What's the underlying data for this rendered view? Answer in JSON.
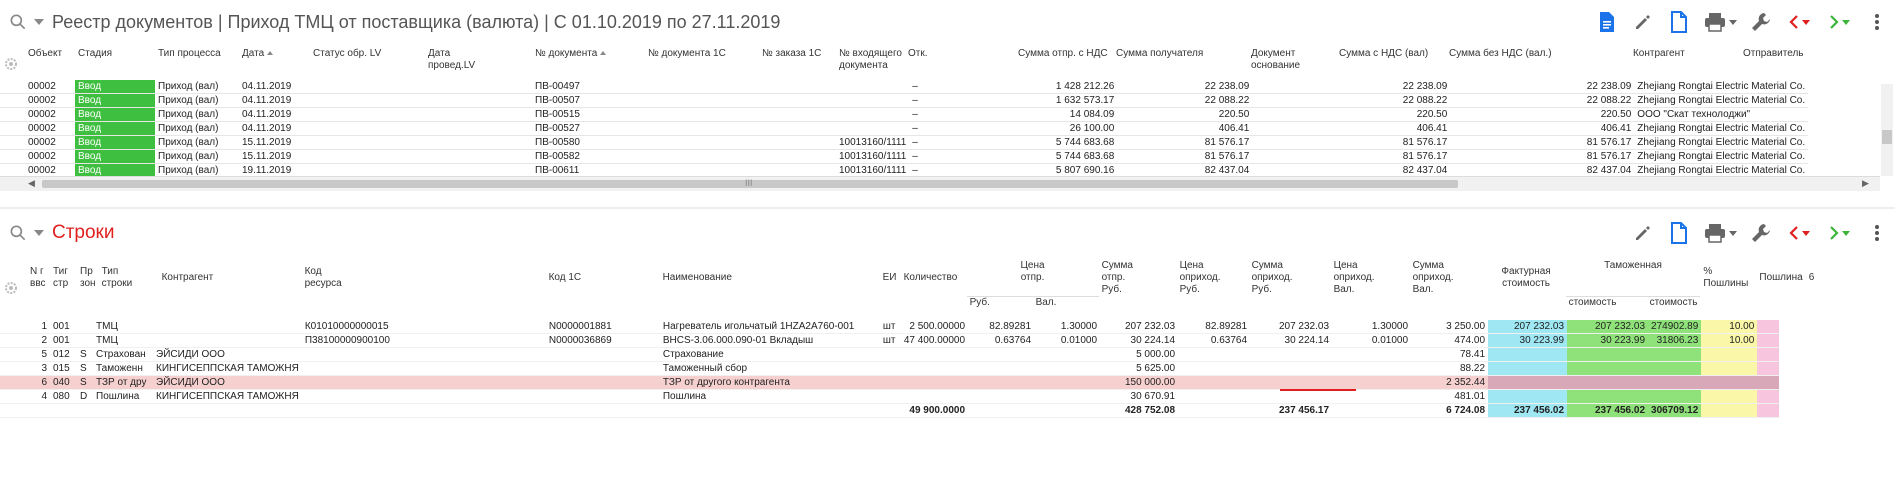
{
  "top_panel": {
    "title": "Реестр документов | Приход ТМЦ от поставщика (валюта) | С 01.10.2019 по 27.11.2019",
    "columns": [
      "Объект",
      "Стадия",
      "Тип процесса",
      "Дата",
      "Статус обр. LV",
      "Дата проведLV",
      "№ документа",
      "№ документа 1С",
      "№ заказа 1С",
      "№ входящего документа",
      "Отк.",
      "Сумма отпр. с НДС",
      "Сумма получателя",
      "Документ основание",
      "Сумма с НДС (вал)",
      "Сумма без НДС (вал.)",
      "Контрагент",
      "Отправитель"
    ],
    "col_labels": {
      "obj": "Объект",
      "stage": "Стадия",
      "proc": "Тип процесса",
      "date": "Дата",
      "status": "Статус обр. LV",
      "dprov1": "Дата",
      "dprov2": "провед.LV",
      "docno": "№ документа",
      "doc1c": "№ документа 1С",
      "order1c": "№ заказа 1С",
      "incoming1": "№ входящего",
      "incoming2": "документа",
      "otk": "Отк.",
      "sum_otpr": "Сумма отпр. с НДС",
      "sum_pol": "Сумма получателя",
      "osn1": "Документ",
      "osn2": "основание",
      "sum_nds": "Сумма с НДС (вал)",
      "sum_bez": "Сумма без НДС (вал.)",
      "contr": "Контрагент",
      "sender": "Отправитель"
    },
    "rows": [
      {
        "obj": "00002",
        "stage": "Ввод",
        "proc": "Приход (вал)",
        "date": "04.11.2019",
        "docno": "ПВ-00497",
        "incoming": "",
        "otk": "–",
        "sum_otpr": "1 428 212.26",
        "sum_pol": "22 238.09",
        "sum_nds": "22 238.09",
        "sum_bez": "22 238.09",
        "contr": "Zhejiang Rongtai Electric Material Co."
      },
      {
        "obj": "00002",
        "stage": "Ввод",
        "proc": "Приход (вал)",
        "date": "04.11.2019",
        "docno": "ПВ-00507",
        "incoming": "",
        "otk": "–",
        "sum_otpr": "1 632 573.17",
        "sum_pol": "22 088.22",
        "sum_nds": "22 088.22",
        "sum_bez": "22 088.22",
        "contr": "Zhejiang Rongtai Electric Material Co."
      },
      {
        "obj": "00002",
        "stage": "Ввод",
        "proc": "Приход (вал)",
        "date": "04.11.2019",
        "docno": "ПВ-00515",
        "incoming": "",
        "otk": "–",
        "sum_otpr": "14 084.09",
        "sum_pol": "220.50",
        "sum_nds": "220.50",
        "sum_bez": "220.50",
        "contr": "ООО \"Скат технолоджи\""
      },
      {
        "obj": "00002",
        "stage": "Ввод",
        "proc": "Приход (вал)",
        "date": "04.11.2019",
        "docno": "ПВ-00527",
        "incoming": "",
        "otk": "–",
        "sum_otpr": "26 100.00",
        "sum_pol": "406.41",
        "sum_nds": "406.41",
        "sum_bez": "406.41",
        "contr": "Zhejiang Rongtai Electric Material Co."
      },
      {
        "obj": "00002",
        "stage": "Ввод",
        "proc": "Приход (вал)",
        "date": "15.11.2019",
        "docno": "ПВ-00580",
        "incoming": "10013160/1111",
        "otk": "–",
        "sum_otpr": "5 744 683.68",
        "sum_pol": "81 576.17",
        "sum_nds": "81 576.17",
        "sum_bez": "81 576.17",
        "contr": "Zhejiang Rongtai Electric Material Co."
      },
      {
        "obj": "00002",
        "stage": "Ввод",
        "proc": "Приход (вал)",
        "date": "15.11.2019",
        "docno": "ПВ-00582",
        "incoming": "10013160/1111",
        "otk": "–",
        "sum_otpr": "5 744 683.68",
        "sum_pol": "81 576.17",
        "sum_nds": "81 576.17",
        "sum_bez": "81 576.17",
        "contr": "Zhejiang Rongtai Electric Material Co."
      },
      {
        "obj": "00002",
        "stage": "Ввод",
        "proc": "Приход (вал)",
        "date": "19.11.2019",
        "docno": "ПВ-00611",
        "incoming": "10013160/1111",
        "otk": "–",
        "sum_otpr": "5 807 690.16",
        "sum_pol": "82 437.04",
        "sum_nds": "82 437.04",
        "sum_bez": "82 437.04",
        "contr": "Zhejiang Rongtai Electric Material Co."
      }
    ],
    "scroll_grip": "III"
  },
  "bottom_panel": {
    "title": "Строки",
    "col_labels": {
      "n1": "N г",
      "n2": "ввс",
      "tip1": "Тиг",
      "tip2": "стр",
      "pr1": "Пр",
      "pr2": "зон",
      "tipstr1": "Тип",
      "tipstr2": "строки",
      "contr": "Контрагент",
      "kod1": "Код",
      "kod2": "ресурса",
      "kod1c": "Код 1С",
      "name": "Наименование",
      "ei": "ЕИ",
      "qty": "Количество",
      "price1": "Цена",
      "price2": "отпр.",
      "rub": "Руб.",
      "val": "Вал.",
      "sumotpr1": "Сумма",
      "sumotpr2": "отпр.",
      "sumotpr3": "Руб.",
      "cenaopr1": "Цена",
      "cenaopr2": "оприход.",
      "cenaopr3": "Руб.",
      "sumopr1": "Сумма",
      "sumopr2": "оприход.",
      "sumopr3": "Руб.",
      "cenaoprv1": "Цена",
      "cenaoprv2": "оприход.",
      "cenaoprv3": "Вал.",
      "sumoprv1": "Сумма",
      "sumoprv2": "оприход.",
      "sumoprv3": "Вал.",
      "fakt1": "Фактурная",
      "fakt2": "стоимость",
      "tam": "Таможенная",
      "stoim_a": "стоимость",
      "stoim_b": "стоимость",
      "pct1": "%",
      "pct2": "Пошлины",
      "poshlina": "Пошлина",
      "extra": "6"
    },
    "rows": [
      {
        "n": "1",
        "tip": "001",
        "pr": "",
        "tipstr": "ТМЦ",
        "contr": "",
        "kod": "К01010000000015",
        "kod1c": "N0000001881",
        "name": "Нагреватель игольчатый 1HZA2A760-001",
        "ei": "шт",
        "qty": "2 500.00000",
        "price_rub": "82.89281",
        "price_val": "1.30000",
        "sum_otpr": "207 232.03",
        "cena_opr": "82.89281",
        "sum_opr": "207 232.03",
        "cena_oprv": "1.30000",
        "sum_oprv": "3 250.00",
        "fakt": "207 232.03",
        "tam_a": "207 232.03",
        "tam_b": "274902.89",
        "pct": "10.00",
        "poshlina": "",
        "hl": false
      },
      {
        "n": "2",
        "tip": "001",
        "pr": "",
        "tipstr": "ТМЦ",
        "contr": "",
        "kod": "П38100000900100",
        "kod1c": "N0000036869",
        "name": "BHCS-3.06.000.090-01 Вкладыш",
        "ei": "шт",
        "qty": "47 400.00000",
        "price_rub": "0.63764",
        "price_val": "0.01000",
        "sum_otpr": "30 224.14",
        "cena_opr": "0.63764",
        "sum_opr": "30 224.14",
        "cena_oprv": "0.01000",
        "sum_oprv": "474.00",
        "fakt": "30 223.99",
        "tam_a": "30 223.99",
        "tam_b": "31806.23",
        "pct": "10.00",
        "poshlina": "",
        "hl": false
      },
      {
        "n": "5",
        "tip": "012",
        "pr": "S",
        "tipstr": "Страхован",
        "contr": "ЭЙСИДИ ООО",
        "kod": "",
        "kod1c": "",
        "name": "Страхование",
        "ei": "",
        "qty": "",
        "price_rub": "",
        "price_val": "",
        "sum_otpr": "5 000.00",
        "cena_opr": "",
        "sum_opr": "",
        "cena_oprv": "",
        "sum_oprv": "78.41",
        "fakt": "",
        "tam_a": "",
        "tam_b": "",
        "pct": "",
        "poshlina": "",
        "hl": false
      },
      {
        "n": "3",
        "tip": "015",
        "pr": "S",
        "tipstr": "Таможенн",
        "contr": "КИНГИСЕППСКАЯ ТАМОЖНЯ",
        "kod": "",
        "kod1c": "",
        "name": "Таможенный сбор",
        "ei": "",
        "qty": "",
        "price_rub": "",
        "price_val": "",
        "sum_otpr": "5 625.00",
        "cena_opr": "",
        "sum_opr": "",
        "cena_oprv": "",
        "sum_oprv": "88.22",
        "fakt": "",
        "tam_a": "",
        "tam_b": "",
        "pct": "",
        "poshlina": "",
        "hl": false
      },
      {
        "n": "6",
        "tip": "040",
        "pr": "S",
        "tipstr": "ТЗР от дру",
        "contr": "ЭЙСИДИ ООО",
        "kod": "",
        "kod1c": "",
        "name": "ТЗР от другого контрагента",
        "ei": "",
        "qty": "",
        "price_rub": "",
        "price_val": "",
        "sum_otpr": "150 000.00",
        "cena_opr": "",
        "sum_opr": "",
        "cena_oprv": "",
        "sum_oprv": "2 352.44",
        "fakt": "",
        "tam_a": "",
        "tam_b": "",
        "pct": "",
        "poshlina": "",
        "hl": true
      },
      {
        "n": "4",
        "tip": "080",
        "pr": "D",
        "tipstr": "Пошлина",
        "contr": "КИНГИСЕППСКАЯ ТАМОЖНЯ",
        "kod": "",
        "kod1c": "",
        "name": "Пошлина",
        "ei": "",
        "qty": "",
        "price_rub": "",
        "price_val": "",
        "sum_otpr": "30 670.91",
        "cena_opr": "",
        "sum_opr": "",
        "cena_oprv": "",
        "sum_oprv": "481.01",
        "fakt": "",
        "tam_a": "",
        "tam_b": "",
        "pct": "",
        "poshlina": "",
        "hl": false
      }
    ],
    "totals": {
      "qty": "49 900.0000",
      "sum_otpr": "428 752.08",
      "sum_opr": "237 456.17",
      "sum_oprv": "6 724.08",
      "fakt": "237 456.02",
      "tam_a": "237 456.02",
      "tam_b": "306709.12"
    }
  },
  "colors": {
    "accent": "#1a73e8",
    "danger": "#e02020",
    "success": "#3cb43c",
    "stage": "#3fbf3f"
  },
  "icons": [
    "search-icon",
    "document-list-icon",
    "edit-icon",
    "new-document-icon",
    "print-icon",
    "settings-wrench-icon",
    "prev-arrow-icon",
    "next-arrow-icon",
    "more-vert-icon",
    "gear-icon"
  ]
}
